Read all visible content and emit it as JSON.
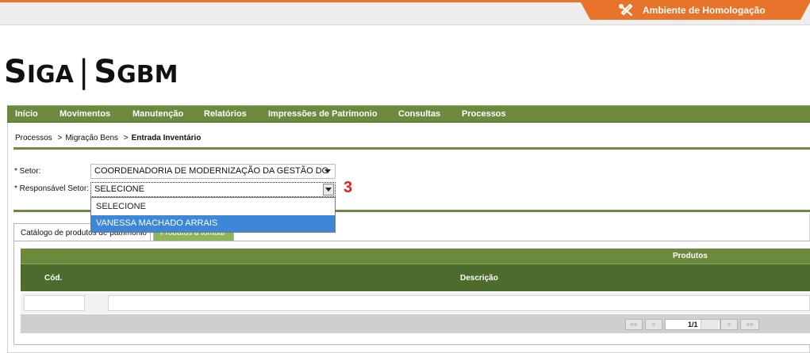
{
  "env": {
    "label": "Ambiente de Homologação",
    "icon": "tools-icon",
    "color": "#e8732a"
  },
  "logo": {
    "text_a": "S",
    "text_b": "I",
    "text_c": "GA",
    "divider": "|",
    "text_d": "S",
    "text_e": "GBM"
  },
  "menu": [
    "Início",
    "Movimentos",
    "Manutenção",
    "Relatórios",
    "Impressões de Patrimonio",
    "Consultas",
    "Processos"
  ],
  "breadcrumb": {
    "items": [
      "Processos",
      "Migração Bens",
      "Entrada Inventário"
    ],
    "separator": ">"
  },
  "form": {
    "setor_label": "* Setor:",
    "setor_value": "COORDENADORIA DE MODERNIZAÇÃO DA GESTÃO DO",
    "responsavel_label": "* Responsável Setor:",
    "responsavel_value": "SELECIONE",
    "responsavel_options": [
      "SELECIONE",
      "VANESSA MACHADO ARRAIS"
    ],
    "highlighted_option": "VANESSA MACHADO ARRAIS"
  },
  "annotation": "3",
  "tabs": [
    {
      "label": "Catálogo de produtos de patrimônio",
      "active": true
    },
    {
      "label": "Produtos a tombar",
      "active": false
    }
  ],
  "table": {
    "group_header": "Produtos",
    "columns": [
      "Cód.",
      "Descrição"
    ]
  },
  "pager": {
    "first": "««",
    "prev": "«",
    "info": "1/1",
    "next": "»",
    "last": "»»"
  },
  "colors": {
    "menu_green": "#6b8a3e",
    "dark_green": "#4d6b2c",
    "tab_green": "#8db55a",
    "highlight_blue": "#3d87d8",
    "annotation_red": "#e02020"
  }
}
